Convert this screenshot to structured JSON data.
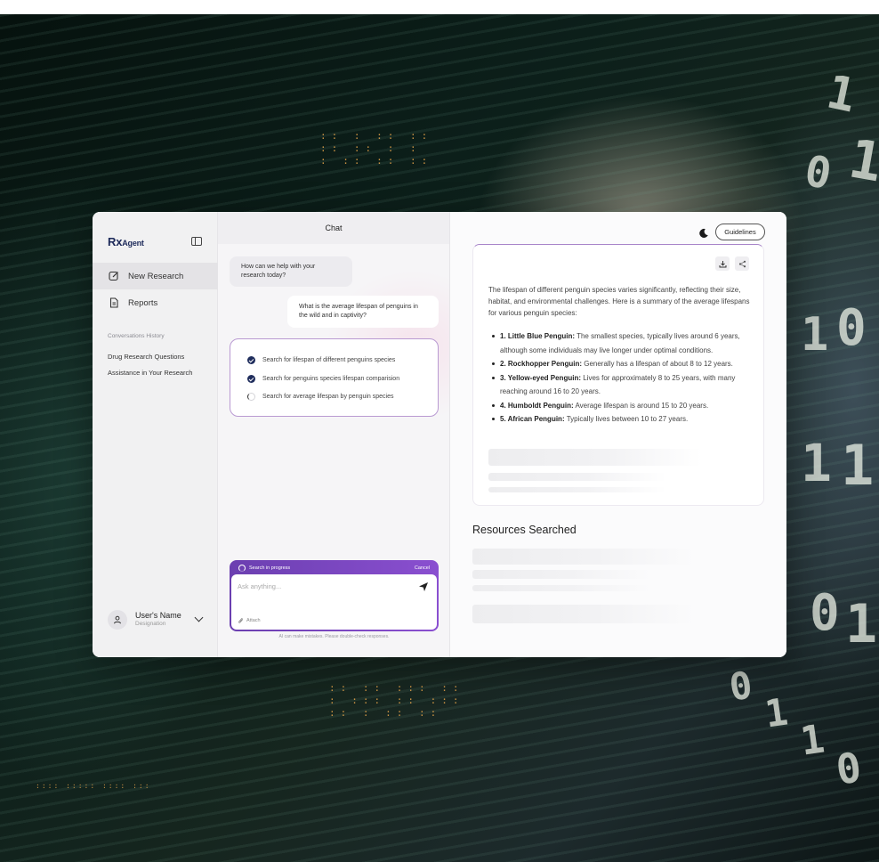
{
  "app": {
    "logo": "RxAgent",
    "logo_main": "Rx",
    "logo_sub": "Agent"
  },
  "sidebar": {
    "nav": [
      {
        "label": "New Research",
        "icon": "edit-icon",
        "active": true
      },
      {
        "label": "Reports",
        "icon": "document-icon",
        "active": false
      }
    ],
    "history_title": "Conversations History",
    "history": [
      "Drug Research Questions",
      "Assistance in Your Research"
    ],
    "user": {
      "name": "User's Name",
      "designation": "Designation"
    }
  },
  "chat": {
    "title": "Chat",
    "bot_greeting": "How can we help with your research today?",
    "user_question": "What is the average lifespan of penguins in the wild and in captivity?",
    "steps": [
      {
        "label": "Search for lifespan of different penguins species",
        "status": "done"
      },
      {
        "label": "Search for penguins species lifespan comparision",
        "status": "done"
      },
      {
        "label": "Search for average lifespan by penguin species",
        "status": "in-progress"
      }
    ],
    "composer": {
      "status": "Search in progress",
      "cancel": "Cancel",
      "placeholder": "Ask anything...",
      "attach": "Attach"
    },
    "disclaimer": "AI can make mistakes. Please double-check responses."
  },
  "report": {
    "guidelines": "Guidelines",
    "intro": "The lifespan of different penguin species varies significantly, reflecting their size, habitat, and environmental challenges. Here is a summary of the average lifespans for various penguin species:",
    "items": [
      {
        "title": "1. Little Blue Penguin:",
        "text": " The smallest species, typically lives around 6 years, although some individuals may live longer under optimal conditions."
      },
      {
        "title": "2. Rockhopper Penguin:",
        "text": " Generally has a lifespan of about 8 to 12 years."
      },
      {
        "title": "3. Yellow-eyed Penguin:",
        "text": " Lives for approximately 8 to 25 years, with many reaching around 16 to 20 years."
      },
      {
        "title": "4. Humboldt Penguin:",
        "text": " Average lifespan is around 15 to 20 years."
      },
      {
        "title": "5. African Penguin:",
        "text": " Typically lives between 10 to 27 years."
      }
    ],
    "resources_title": "Resources Searched"
  },
  "colors": {
    "accent": "#7b4bc4",
    "brand": "#1d2a5a",
    "check": "#1f2d5c"
  },
  "background": {
    "binary": [
      "1",
      "0",
      "1",
      "1",
      "0",
      "1",
      "1",
      "0",
      "1",
      "0",
      "1",
      "1",
      "0"
    ]
  }
}
